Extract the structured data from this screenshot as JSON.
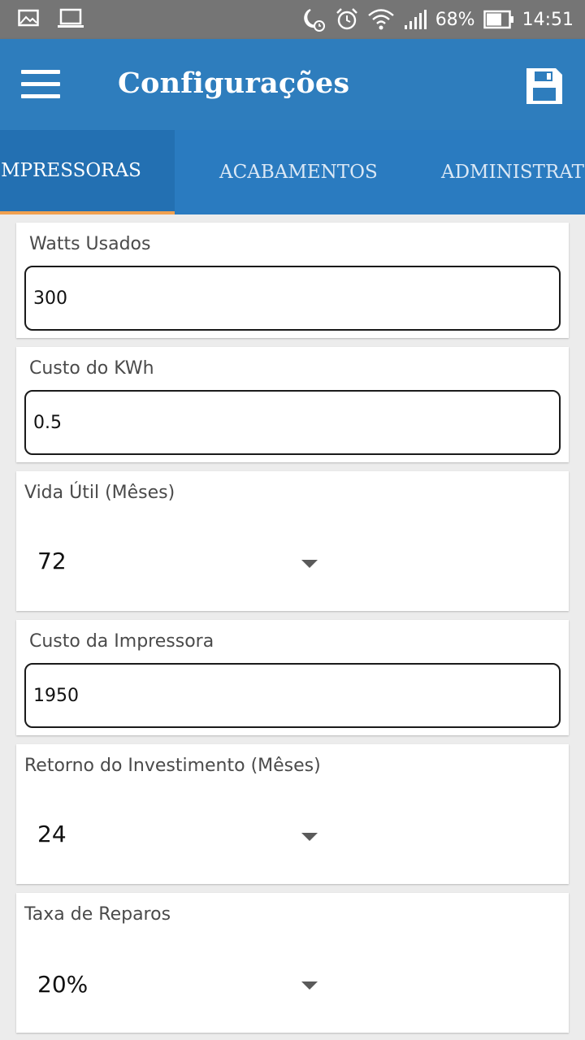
{
  "status_bar": {
    "battery": "68%",
    "time": "14:51",
    "icons": [
      "image-icon",
      "laptop-icon",
      "moon-clock-icon",
      "alarm-icon",
      "wifi-icon",
      "signal-icon",
      "battery-icon"
    ]
  },
  "app_bar": {
    "title": "Configurações",
    "menu_icon": "menu-icon",
    "save_icon": "save-icon",
    "color": "#2e7dbd"
  },
  "tabs": [
    {
      "label": "IMPRESSORAS",
      "active": true
    },
    {
      "label": "ACABAMENTOS",
      "active": false
    },
    {
      "label": "ADMINISTRATIVO",
      "active": false
    }
  ],
  "tab_indicator_color": "#f0a050",
  "form": {
    "watts": {
      "label": "Watts Usados",
      "value": "300"
    },
    "kwh": {
      "label": "Custo do KWh",
      "value": "0.5"
    },
    "vida_util": {
      "label": "Vida Útil (Mêses)",
      "value": "72"
    },
    "custo_impressora": {
      "label": "Custo da Impressora",
      "value": "1950"
    },
    "retorno": {
      "label": "Retorno do Investimento (Mêses)",
      "value": "24"
    },
    "taxa_reparos": {
      "label": "Taxa de Reparos",
      "value": "20%"
    }
  }
}
